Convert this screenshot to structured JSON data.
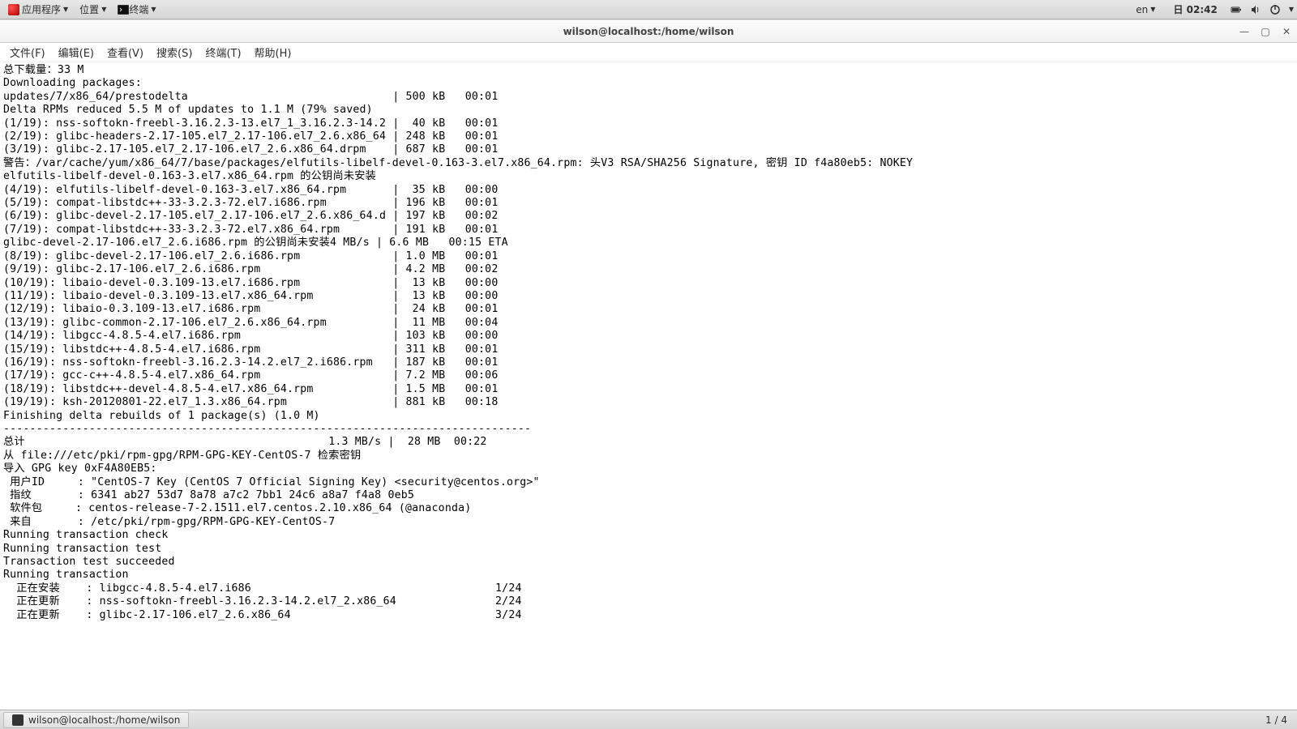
{
  "panel": {
    "apps": "应用程序",
    "places": "位置",
    "terminal_launcher": "终端",
    "lang": "en",
    "clock": "日 02:42"
  },
  "window": {
    "title": "wilson@localhost:/home/wilson"
  },
  "menubar": {
    "file": "文件(F)",
    "edit": "编辑(E)",
    "view": "查看(V)",
    "search": "搜索(S)",
    "terminal": "终端(T)",
    "help": "帮助(H)"
  },
  "terminal_lines": [
    "总下载量：33 M",
    "Downloading packages:",
    "updates/7/x86_64/prestodelta                               | 500 kB   00:01",
    "Delta RPMs reduced 5.5 M of updates to 1.1 M (79% saved)",
    "(1/19): nss-softokn-freebl-3.16.2.3-13.el7_1_3.16.2.3-14.2 |  40 kB   00:01",
    "(2/19): glibc-headers-2.17-105.el7_2.17-106.el7_2.6.x86_64 | 248 kB   00:01",
    "(3/19): glibc-2.17-105.el7_2.17-106.el7_2.6.x86_64.drpm    | 687 kB   00:01",
    "警告：/var/cache/yum/x86_64/7/base/packages/elfutils-libelf-devel-0.163-3.el7.x86_64.rpm: 头V3 RSA/SHA256 Signature, 密钥 ID f4a80eb5: NOKEY",
    "elfutils-libelf-devel-0.163-3.el7.x86_64.rpm 的公钥尚未安装",
    "(4/19): elfutils-libelf-devel-0.163-3.el7.x86_64.rpm       |  35 kB   00:00",
    "(5/19): compat-libstdc++-33-3.2.3-72.el7.i686.rpm          | 196 kB   00:01",
    "(6/19): glibc-devel-2.17-105.el7_2.17-106.el7_2.6.x86_64.d | 197 kB   00:02",
    "(7/19): compat-libstdc++-33-3.2.3-72.el7.x86_64.rpm        | 191 kB   00:01",
    "glibc-devel-2.17-106.el7_2.6.i686.rpm 的公钥尚未安装4 MB/s | 6.6 MB   00:15 ETA",
    "(8/19): glibc-devel-2.17-106.el7_2.6.i686.rpm              | 1.0 MB   00:01",
    "(9/19): glibc-2.17-106.el7_2.6.i686.rpm                    | 4.2 MB   00:02",
    "(10/19): libaio-devel-0.3.109-13.el7.i686.rpm              |  13 kB   00:00",
    "(11/19): libaio-devel-0.3.109-13.el7.x86_64.rpm            |  13 kB   00:00",
    "(12/19): libaio-0.3.109-13.el7.i686.rpm                    |  24 kB   00:01",
    "(13/19): glibc-common-2.17-106.el7_2.6.x86_64.rpm          |  11 MB   00:04",
    "(14/19): libgcc-4.8.5-4.el7.i686.rpm                       | 103 kB   00:00",
    "(15/19): libstdc++-4.8.5-4.el7.i686.rpm                    | 311 kB   00:01",
    "(16/19): nss-softokn-freebl-3.16.2.3-14.2.el7_2.i686.rpm   | 187 kB   00:01",
    "(17/19): gcc-c++-4.8.5-4.el7.x86_64.rpm                    | 7.2 MB   00:06",
    "(18/19): libstdc++-devel-4.8.5-4.el7.x86_64.rpm            | 1.5 MB   00:01",
    "(19/19): ksh-20120801-22.el7_1.3.x86_64.rpm                | 881 kB   00:18",
    "Finishing delta rebuilds of 1 package(s) (1.0 M)",
    "--------------------------------------------------------------------------------",
    "总计                                              1.3 MB/s |  28 MB  00:22",
    "从 file:///etc/pki/rpm-gpg/RPM-GPG-KEY-CentOS-7 检索密钥",
    "导入 GPG key 0xF4A80EB5:",
    " 用户ID     : \"CentOS-7 Key (CentOS 7 Official Signing Key) <security@centos.org>\"",
    " 指纹       : 6341 ab27 53d7 8a78 a7c2 7bb1 24c6 a8a7 f4a8 0eb5",
    " 软件包     : centos-release-7-2.1511.el7.centos.2.10.x86_64 (@anaconda)",
    " 来自       : /etc/pki/rpm-gpg/RPM-GPG-KEY-CentOS-7",
    "Running transaction check",
    "Running transaction test",
    "Transaction test succeeded",
    "Running transaction",
    "  正在安装    : libgcc-4.8.5-4.el7.i686                                     1/24",
    "  正在更新    : nss-softokn-freebl-3.16.2.3-14.2.el7_2.x86_64               2/24",
    "  正在更新    : glibc-2.17-106.el7_2.6.x86_64                               3/24"
  ],
  "taskbar": {
    "task1": "wilson@localhost:/home/wilson",
    "workspace": "1 / 4"
  }
}
